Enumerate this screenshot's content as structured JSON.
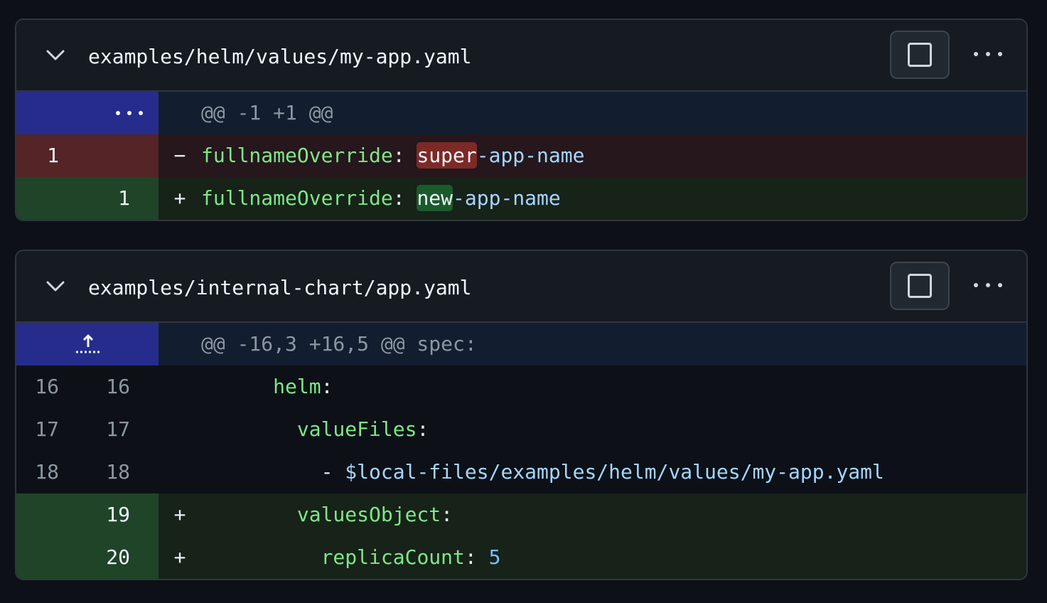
{
  "files": [
    {
      "filename": "examples/helm/values/my-app.yaml",
      "hunk_header": "@@ -1 +1 @@",
      "del_line": {
        "old": "1",
        "sign": "−",
        "key": "fullnameOverride",
        "colon": ":",
        "sp": " ",
        "changed": "super",
        "rest": "-app-name"
      },
      "add_line": {
        "new": "1",
        "sign": "+",
        "key": "fullnameOverride",
        "colon": ":",
        "sp": " ",
        "changed": "new",
        "rest": "-app-name"
      }
    },
    {
      "filename": "examples/internal-chart/app.yaml",
      "hunk_header": "@@ -16,3 +16,5 @@ spec:",
      "context": [
        {
          "old": "16",
          "new": "16",
          "indent": "      ",
          "key": "helm",
          "colon": ":"
        },
        {
          "old": "17",
          "new": "17",
          "indent": "        ",
          "key": "valueFiles",
          "colon": ":"
        },
        {
          "old": "18",
          "new": "18",
          "indent": "          ",
          "dash": "- ",
          "value": "$local-files/examples/helm/values/my-app.yaml"
        }
      ],
      "added": [
        {
          "new": "19",
          "sign": "+",
          "indent": "        ",
          "key": "valuesObject",
          "colon": ":"
        },
        {
          "new": "20",
          "sign": "+",
          "indent": "          ",
          "key": "replicaCount",
          "colon": ": ",
          "value": "5"
        }
      ]
    }
  ],
  "icons": {
    "collapse": "chevron-down-icon",
    "view_file": "square-icon",
    "more": "kebab-horizontal-icon",
    "expand_hunk": "dots-icon",
    "expand_up": "fold-up-icon"
  }
}
